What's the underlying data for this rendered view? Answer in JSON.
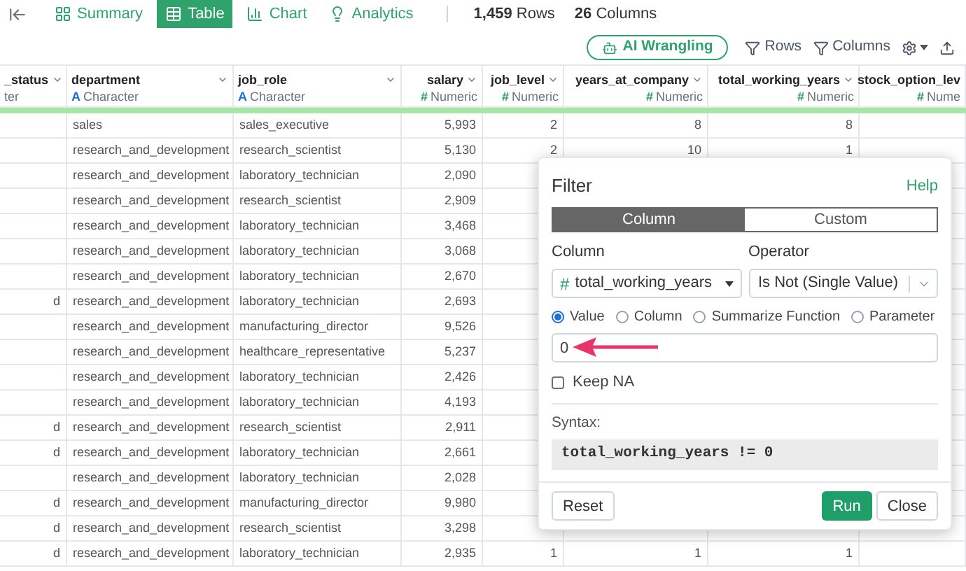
{
  "nav": {
    "tabs": [
      {
        "label": "Summary",
        "kind": "summary",
        "selected": false
      },
      {
        "label": "Table",
        "kind": "table",
        "selected": true
      },
      {
        "label": "Chart",
        "kind": "chart",
        "selected": false
      },
      {
        "label": "Analytics",
        "kind": "analytics",
        "selected": false
      }
    ],
    "row_count": "1,459",
    "row_label": "Rows",
    "column_count": "26",
    "column_label": "Columns"
  },
  "toolbar": {
    "ai_button": "AI Wrangling",
    "rows_filter": "Rows",
    "columns_filter": "Columns"
  },
  "table": {
    "columns": [
      {
        "name": "_status",
        "type": "ter",
        "kind": "cut"
      },
      {
        "name": "department",
        "type_icon": "A",
        "type": "Character",
        "kind": "character"
      },
      {
        "name": "job_role",
        "type_icon": "A",
        "type": "Character",
        "kind": "character"
      },
      {
        "name": "salary",
        "type_icon": "#",
        "type": "Numeric",
        "kind": "numeric"
      },
      {
        "name": "job_level",
        "type_icon": "#",
        "type": "Numeric",
        "kind": "numeric"
      },
      {
        "name": "years_at_company",
        "type_icon": "#",
        "type": "Numeric",
        "kind": "numeric"
      },
      {
        "name": "total_working_years",
        "type_icon": "#",
        "type": "Numeric",
        "kind": "numeric"
      },
      {
        "name": "stock_option_lev",
        "type_icon": "#",
        "type": "Nume",
        "kind": "numeric"
      }
    ],
    "rows": [
      [
        null,
        "sales",
        "sales_executive",
        "5,993",
        "2",
        "8",
        "8",
        null
      ],
      [
        null,
        "research_and_development",
        "research_scientist",
        "5,130",
        "2",
        "10",
        "1",
        null
      ],
      [
        null,
        "research_and_development",
        "laboratory_technician",
        "2,090",
        null,
        null,
        null,
        null
      ],
      [
        null,
        "research_and_development",
        "research_scientist",
        "2,909",
        null,
        null,
        null,
        null
      ],
      [
        null,
        "research_and_development",
        "laboratory_technician",
        "3,468",
        null,
        null,
        null,
        null
      ],
      [
        null,
        "research_and_development",
        "laboratory_technician",
        "3,068",
        null,
        null,
        null,
        null
      ],
      [
        null,
        "research_and_development",
        "laboratory_technician",
        "2,670",
        null,
        null,
        null,
        null
      ],
      [
        "d",
        "research_and_development",
        "laboratory_technician",
        "2,693",
        null,
        null,
        null,
        null
      ],
      [
        null,
        "research_and_development",
        "manufacturing_director",
        "9,526",
        null,
        null,
        null,
        null
      ],
      [
        null,
        "research_and_development",
        "healthcare_representative",
        "5,237",
        null,
        null,
        null,
        null
      ],
      [
        null,
        "research_and_development",
        "laboratory_technician",
        "2,426",
        null,
        null,
        null,
        null
      ],
      [
        null,
        "research_and_development",
        "laboratory_technician",
        "4,193",
        null,
        null,
        null,
        null
      ],
      [
        "d",
        "research_and_development",
        "research_scientist",
        "2,911",
        null,
        null,
        null,
        null
      ],
      [
        "d",
        "research_and_development",
        "laboratory_technician",
        "2,661",
        null,
        null,
        null,
        null
      ],
      [
        null,
        "research_and_development",
        "laboratory_technician",
        "2,028",
        null,
        null,
        null,
        null
      ],
      [
        "d",
        "research_and_development",
        "manufacturing_director",
        "9,980",
        null,
        null,
        null,
        null
      ],
      [
        "d",
        "research_and_development",
        "research_scientist",
        "3,298",
        null,
        null,
        null,
        null
      ],
      [
        "d",
        "research_and_development",
        "laboratory_technician",
        "2,935",
        "1",
        "1",
        "1",
        null
      ]
    ]
  },
  "dialog": {
    "title": "Filter",
    "help": "Help",
    "modes": [
      {
        "label": "Column",
        "selected": true
      },
      {
        "label": "Custom",
        "selected": false
      }
    ],
    "column_label": "Column",
    "column_icon": "#",
    "column_value": "total_working_years",
    "operator_label": "Operator",
    "operator_value": "Is Not (Single Value)",
    "value_sources": [
      {
        "label": "Value",
        "selected": true
      },
      {
        "label": "Column",
        "selected": false
      },
      {
        "label": "Summarize Function",
        "selected": false
      },
      {
        "label": "Parameter",
        "selected": false
      }
    ],
    "value": "0",
    "keep_na": {
      "label": "Keep NA",
      "checked": false
    },
    "syntax_label": "Syntax:",
    "syntax": "total_working_years != 0",
    "buttons": {
      "reset": "Reset",
      "run": "Run",
      "close": "Close"
    }
  }
}
